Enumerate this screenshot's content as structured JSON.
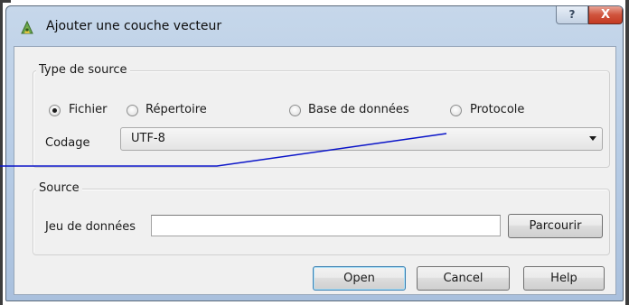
{
  "window": {
    "title": "Ajouter une couche vecteur",
    "help_glyph": "?",
    "close_glyph": "X"
  },
  "source_type": {
    "title": "Type de source",
    "options": [
      {
        "label": "Fichier",
        "checked": true
      },
      {
        "label": "Répertoire",
        "checked": false
      },
      {
        "label": "Base de données",
        "checked": false
      },
      {
        "label": "Protocole",
        "checked": false
      }
    ],
    "encoding_label": "Codage",
    "encoding_value": "UTF-8"
  },
  "source": {
    "title": "Source",
    "dataset_label": "Jeu de données",
    "dataset_value": "",
    "browse_label": "Parcourir"
  },
  "buttons": {
    "open": "Open",
    "cancel": "Cancel",
    "help": "Help"
  },
  "colors": {
    "annotation_line": "#0a14c8",
    "title_gradient_top": "#c6d7ea",
    "close_button": "#c43a22"
  }
}
